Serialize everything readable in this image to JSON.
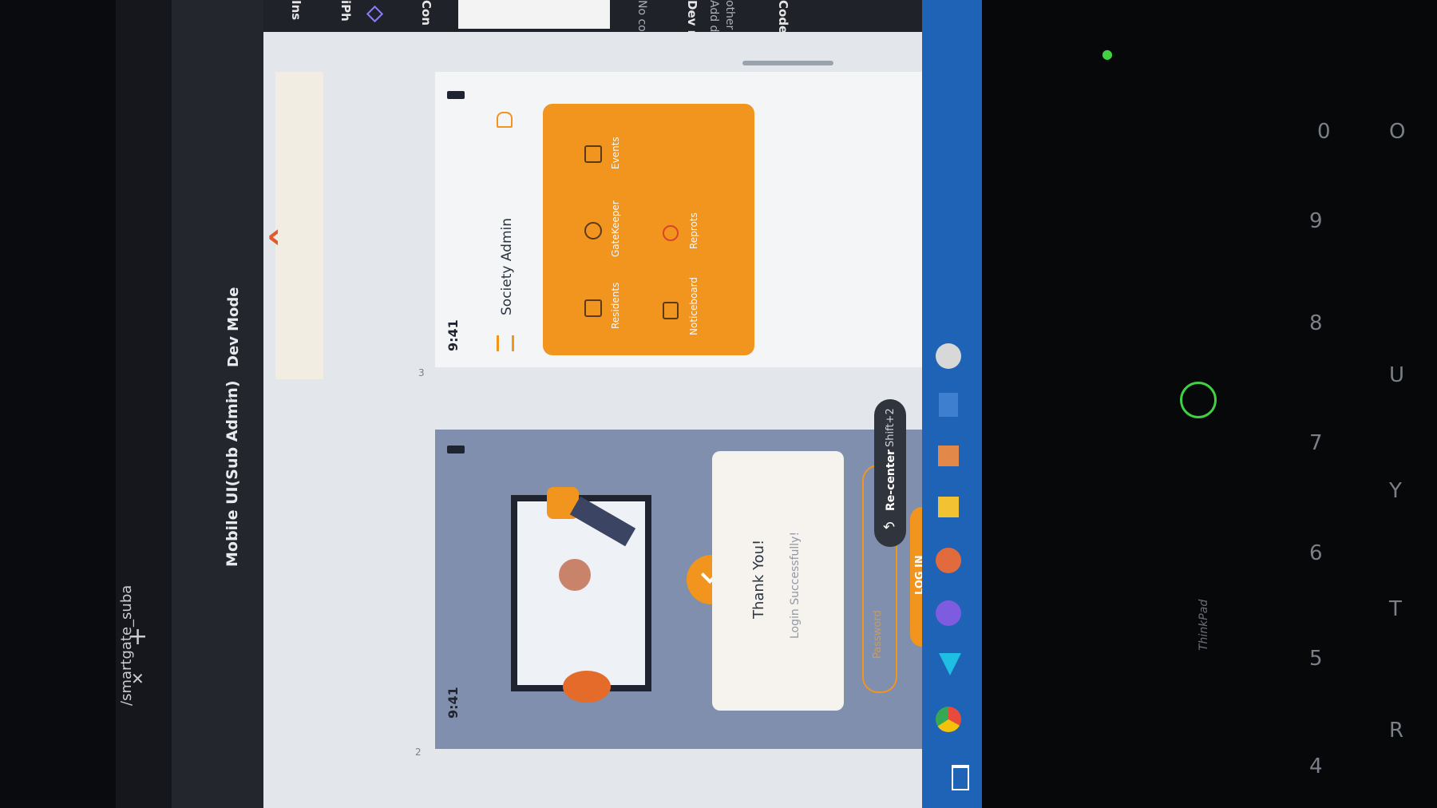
{
  "tab": {
    "title": "/smartgate_suba",
    "close": "✕",
    "add": "+"
  },
  "toolbar": {
    "project_name": "Mobile UI(Sub Admin)",
    "mode": "Dev Mode"
  },
  "right_panel": {
    "items": [
      "Ins",
      "iPh",
      "Con",
      "No co",
      "Dev re",
      "Add d",
      "other t",
      "Code"
    ]
  },
  "frames": {
    "login": {
      "number": "2",
      "time": "9:41",
      "thank_you": "Thank You!",
      "success": "Login Successfully!",
      "password_placeholder": "Password",
      "login_button": "LOG IN"
    },
    "dashboard": {
      "number": "3",
      "time": "9:41",
      "title": "Society Admin",
      "menu": [
        {
          "label": "Residents",
          "icon": "residents-icon"
        },
        {
          "label": "GateKeeper",
          "icon": "gatekeeper-icon"
        },
        {
          "label": "Events",
          "icon": "events-icon"
        },
        {
          "label": "Noticeboard",
          "icon": "noticeboard-icon"
        },
        {
          "label": "Reprots",
          "icon": "reports-icon"
        }
      ]
    }
  },
  "recenter": {
    "label": "Re-center",
    "shortcut": "Shift+2"
  },
  "keyboard": {
    "brand": "ThinkPad"
  },
  "colors": {
    "accent": "#f2951e",
    "back_arrow": "#e05a2b",
    "taskbar": "#1e63b5"
  }
}
